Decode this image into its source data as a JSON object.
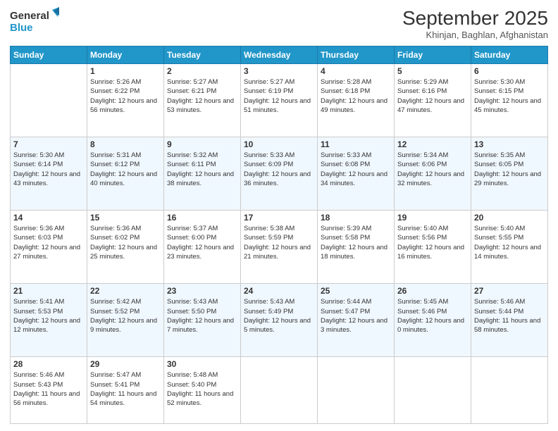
{
  "logo": {
    "line1": "General",
    "line2": "Blue"
  },
  "title": "September 2025",
  "location": "Khinjan, Baghlan, Afghanistan",
  "days_of_week": [
    "Sunday",
    "Monday",
    "Tuesday",
    "Wednesday",
    "Thursday",
    "Friday",
    "Saturday"
  ],
  "weeks": [
    [
      null,
      {
        "num": "1",
        "sunrise": "5:26 AM",
        "sunset": "6:22 PM",
        "daylight": "12 hours and 56 minutes."
      },
      {
        "num": "2",
        "sunrise": "5:27 AM",
        "sunset": "6:21 PM",
        "daylight": "12 hours and 53 minutes."
      },
      {
        "num": "3",
        "sunrise": "5:27 AM",
        "sunset": "6:19 PM",
        "daylight": "12 hours and 51 minutes."
      },
      {
        "num": "4",
        "sunrise": "5:28 AM",
        "sunset": "6:18 PM",
        "daylight": "12 hours and 49 minutes."
      },
      {
        "num": "5",
        "sunrise": "5:29 AM",
        "sunset": "6:16 PM",
        "daylight": "12 hours and 47 minutes."
      },
      {
        "num": "6",
        "sunrise": "5:30 AM",
        "sunset": "6:15 PM",
        "daylight": "12 hours and 45 minutes."
      }
    ],
    [
      {
        "num": "7",
        "sunrise": "5:30 AM",
        "sunset": "6:14 PM",
        "daylight": "12 hours and 43 minutes."
      },
      {
        "num": "8",
        "sunrise": "5:31 AM",
        "sunset": "6:12 PM",
        "daylight": "12 hours and 40 minutes."
      },
      {
        "num": "9",
        "sunrise": "5:32 AM",
        "sunset": "6:11 PM",
        "daylight": "12 hours and 38 minutes."
      },
      {
        "num": "10",
        "sunrise": "5:33 AM",
        "sunset": "6:09 PM",
        "daylight": "12 hours and 36 minutes."
      },
      {
        "num": "11",
        "sunrise": "5:33 AM",
        "sunset": "6:08 PM",
        "daylight": "12 hours and 34 minutes."
      },
      {
        "num": "12",
        "sunrise": "5:34 AM",
        "sunset": "6:06 PM",
        "daylight": "12 hours and 32 minutes."
      },
      {
        "num": "13",
        "sunrise": "5:35 AM",
        "sunset": "6:05 PM",
        "daylight": "12 hours and 29 minutes."
      }
    ],
    [
      {
        "num": "14",
        "sunrise": "5:36 AM",
        "sunset": "6:03 PM",
        "daylight": "12 hours and 27 minutes."
      },
      {
        "num": "15",
        "sunrise": "5:36 AM",
        "sunset": "6:02 PM",
        "daylight": "12 hours and 25 minutes."
      },
      {
        "num": "16",
        "sunrise": "5:37 AM",
        "sunset": "6:00 PM",
        "daylight": "12 hours and 23 minutes."
      },
      {
        "num": "17",
        "sunrise": "5:38 AM",
        "sunset": "5:59 PM",
        "daylight": "12 hours and 21 minutes."
      },
      {
        "num": "18",
        "sunrise": "5:39 AM",
        "sunset": "5:58 PM",
        "daylight": "12 hours and 18 minutes."
      },
      {
        "num": "19",
        "sunrise": "5:40 AM",
        "sunset": "5:56 PM",
        "daylight": "12 hours and 16 minutes."
      },
      {
        "num": "20",
        "sunrise": "5:40 AM",
        "sunset": "5:55 PM",
        "daylight": "12 hours and 14 minutes."
      }
    ],
    [
      {
        "num": "21",
        "sunrise": "5:41 AM",
        "sunset": "5:53 PM",
        "daylight": "12 hours and 12 minutes."
      },
      {
        "num": "22",
        "sunrise": "5:42 AM",
        "sunset": "5:52 PM",
        "daylight": "12 hours and 9 minutes."
      },
      {
        "num": "23",
        "sunrise": "5:43 AM",
        "sunset": "5:50 PM",
        "daylight": "12 hours and 7 minutes."
      },
      {
        "num": "24",
        "sunrise": "5:43 AM",
        "sunset": "5:49 PM",
        "daylight": "12 hours and 5 minutes."
      },
      {
        "num": "25",
        "sunrise": "5:44 AM",
        "sunset": "5:47 PM",
        "daylight": "12 hours and 3 minutes."
      },
      {
        "num": "26",
        "sunrise": "5:45 AM",
        "sunset": "5:46 PM",
        "daylight": "12 hours and 0 minutes."
      },
      {
        "num": "27",
        "sunrise": "5:46 AM",
        "sunset": "5:44 PM",
        "daylight": "11 hours and 58 minutes."
      }
    ],
    [
      {
        "num": "28",
        "sunrise": "5:46 AM",
        "sunset": "5:43 PM",
        "daylight": "11 hours and 56 minutes."
      },
      {
        "num": "29",
        "sunrise": "5:47 AM",
        "sunset": "5:41 PM",
        "daylight": "11 hours and 54 minutes."
      },
      {
        "num": "30",
        "sunrise": "5:48 AM",
        "sunset": "5:40 PM",
        "daylight": "11 hours and 52 minutes."
      },
      null,
      null,
      null,
      null
    ]
  ],
  "labels": {
    "sunrise": "Sunrise:",
    "sunset": "Sunset:",
    "daylight": "Daylight:"
  }
}
